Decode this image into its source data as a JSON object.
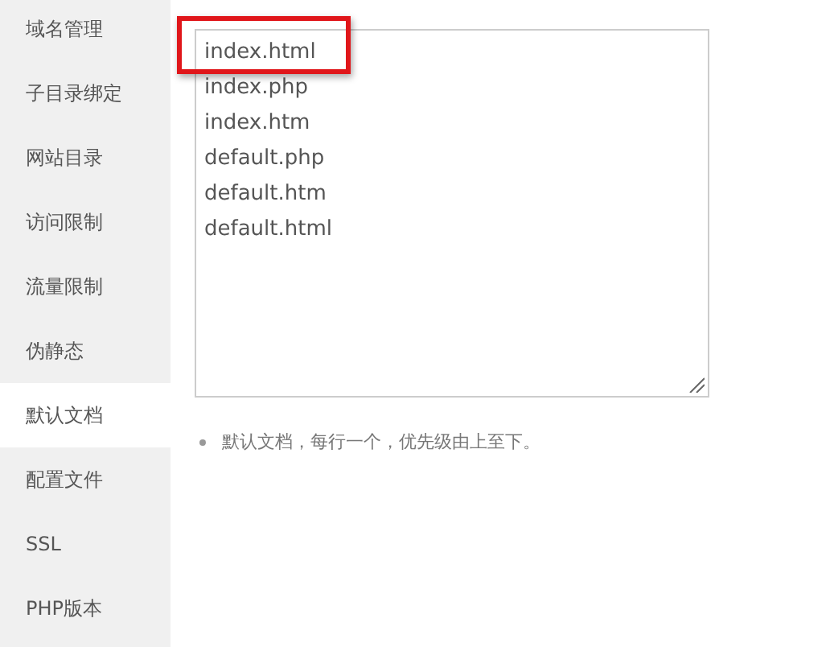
{
  "sidebar": {
    "items": [
      {
        "label": "域名管理",
        "selected": false
      },
      {
        "label": "子目录绑定",
        "selected": false
      },
      {
        "label": "网站目录",
        "selected": false
      },
      {
        "label": "访问限制",
        "selected": false
      },
      {
        "label": "流量限制",
        "selected": false
      },
      {
        "label": "伪静态",
        "selected": false
      },
      {
        "label": "默认文档",
        "selected": true
      },
      {
        "label": "配置文件",
        "selected": false
      },
      {
        "label": "SSL",
        "selected": false
      },
      {
        "label": "PHP版本",
        "selected": false
      }
    ]
  },
  "editor": {
    "lines": [
      {
        "text": "index.html",
        "highlighted": true
      },
      {
        "text": "index.php",
        "highlighted": false
      },
      {
        "text": "index.htm",
        "highlighted": false
      },
      {
        "text": "default.php",
        "highlighted": false
      },
      {
        "text": "default.htm",
        "highlighted": false
      },
      {
        "text": "default.html",
        "highlighted": false
      }
    ]
  },
  "hints": [
    "默认文档，每行一个，优先级由上至下。"
  ]
}
